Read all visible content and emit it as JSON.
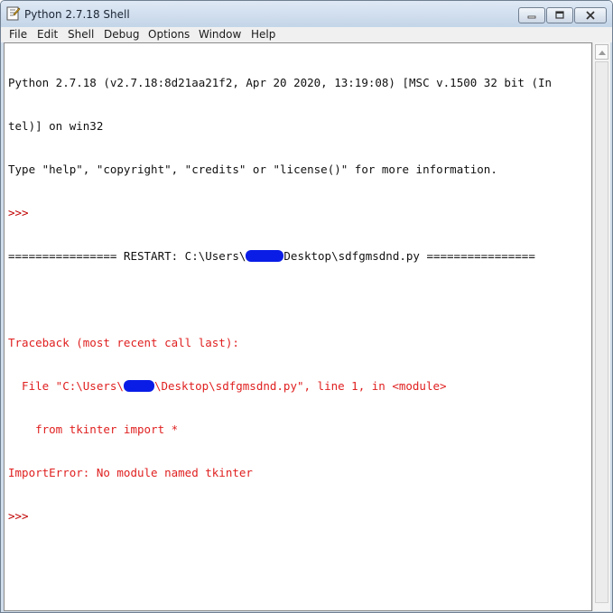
{
  "window": {
    "title": "Python 2.7.18 Shell",
    "icon": "python-idle-icon"
  },
  "controls": {
    "minimize_icon": "minimize-icon",
    "maximize_icon": "maximize-icon",
    "close_icon": "close-icon"
  },
  "menu": [
    "File",
    "Edit",
    "Shell",
    "Debug",
    "Options",
    "Window",
    "Help"
  ],
  "shell": {
    "banner_line1": "Python 2.7.18 (v2.7.18:8d21aa21f2, Apr 20 2020, 13:19:08) [MSC v.1500 32 bit (In",
    "banner_line2": "tel)] on win32",
    "banner_line3": "Type \"help\", \"copyright\", \"credits\" or \"license()\" for more information.",
    "prompt": ">>>",
    "restart_prefix": "================ RESTART: C:\\Users\\",
    "restart_suffix": "Desktop\\sdfgmsdnd.py ================",
    "traceback_header": "Traceback (most recent call last):",
    "file_prefix": "  File \"C:\\Users\\",
    "file_suffix": "\\Desktop\\sdfgmsdnd.py\", line 1, in <module>",
    "source_line": "    from tkinter import *",
    "error_line": "ImportError: No module named tkinter",
    "final_prompt": ">>>"
  },
  "colors": {
    "error": "#e02020",
    "prompt": "#c00000",
    "redaction": "#0a1de6"
  }
}
